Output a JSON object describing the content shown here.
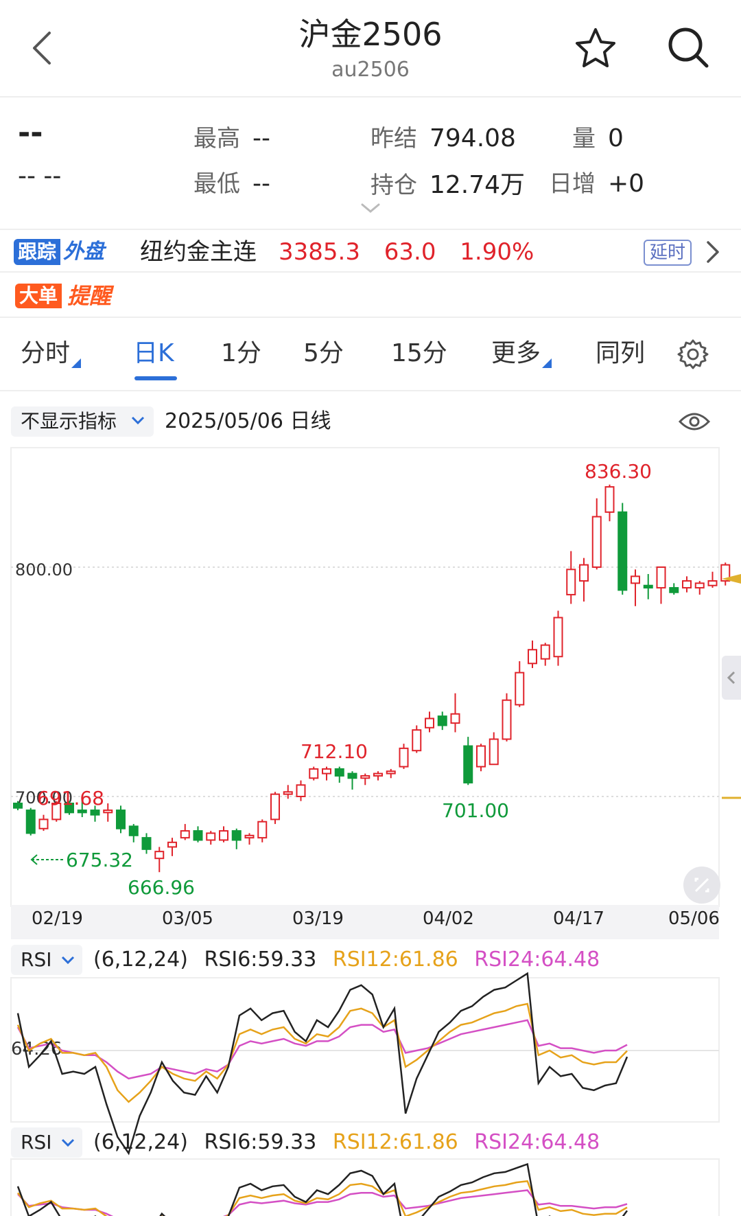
{
  "header": {
    "title": "沪金2506",
    "subtitle": "au2506",
    "icons": [
      "chevron-left-icon",
      "star-icon",
      "search-icon"
    ]
  },
  "quote": {
    "last_price": "--",
    "last_change": "-- --",
    "high_label": "最高",
    "high_value": "--",
    "low_label": "最低",
    "low_value": "--",
    "prev_settle_label": "昨结",
    "prev_settle_value": "794.08",
    "open_interest_label": "持仓",
    "open_interest_value": "12.74万",
    "volume_label": "量",
    "volume_value": "0",
    "daily_increase_label": "日增",
    "daily_increase_value": "+0"
  },
  "tracking": {
    "badge_a": "跟踪",
    "badge_b": "外盘",
    "name": "纽约金主连",
    "price": "3385.3",
    "change": "63.0",
    "change_pct": "1.90%",
    "delay_tag": "延时",
    "color": "#e0232b"
  },
  "big_order": {
    "badge_a": "大单",
    "badge_b": "提醒"
  },
  "tabs": [
    {
      "label": "分时",
      "has_menu": true
    },
    {
      "label": "日K",
      "active": true
    },
    {
      "label": "1分"
    },
    {
      "label": "5分"
    },
    {
      "label": "15分"
    },
    {
      "label": "更多",
      "has_menu": true
    },
    {
      "label": "同列"
    }
  ],
  "indicator_bar": {
    "select_label": "不显示指标",
    "date_label": "2025/05/06  日线"
  },
  "chart_data": {
    "type": "candlestick",
    "y_ticks": [
      "800.00",
      "700.00"
    ],
    "x_ticks": [
      "02/19",
      "03/05",
      "03/19",
      "04/02",
      "04/17",
      "05/06"
    ],
    "annotations": [
      {
        "text": "836.30",
        "kind": "high"
      },
      {
        "text": "712.10",
        "kind": "high"
      },
      {
        "text": "691.68",
        "kind": "high"
      },
      {
        "text": "701.00",
        "kind": "low"
      },
      {
        "text": "666.96",
        "kind": "low"
      },
      {
        "text": "675.32",
        "kind": "low",
        "arrow": true
      }
    ],
    "colors": {
      "up": "#e0232b",
      "down": "#0f9a3a",
      "rsi6": "#222222",
      "rsi12": "#e6a21a",
      "rsi24": "#d44fc4",
      "guide": "#e0b02e"
    },
    "candles": [
      [
        697,
        698,
        694,
        695
      ],
      [
        694,
        695,
        683,
        684
      ],
      [
        686,
        692,
        685,
        690
      ],
      [
        690,
        698,
        689,
        697
      ],
      [
        697,
        698,
        692,
        693
      ],
      [
        694,
        699,
        691,
        693
      ],
      [
        694,
        696,
        689,
        692
      ],
      [
        693,
        697,
        689,
        694
      ],
      [
        694,
        696,
        684,
        686
      ],
      [
        687,
        688,
        680,
        683
      ],
      [
        682,
        684,
        675,
        677
      ],
      [
        673,
        678,
        667,
        676
      ],
      [
        678,
        682,
        674,
        680
      ],
      [
        682,
        688,
        681,
        685
      ],
      [
        685,
        687,
        680,
        681
      ],
      [
        681,
        685,
        679,
        684
      ],
      [
        681,
        687,
        680,
        685
      ],
      [
        685,
        686,
        677,
        681
      ],
      [
        682,
        684,
        679,
        683
      ],
      [
        682,
        690,
        680,
        689
      ],
      [
        690,
        702,
        688,
        701
      ],
      [
        701,
        705,
        699,
        702
      ],
      [
        700,
        707,
        698,
        705
      ],
      [
        708,
        713,
        707,
        712
      ],
      [
        710,
        713,
        707,
        712
      ],
      [
        712,
        713,
        706,
        709
      ],
      [
        710,
        711,
        703,
        708
      ],
      [
        708,
        710,
        705,
        709
      ],
      [
        709,
        711,
        707,
        710
      ],
      [
        710,
        712,
        708,
        711
      ],
      [
        713,
        723,
        712,
        721
      ],
      [
        720,
        731,
        719,
        729
      ],
      [
        730,
        737,
        728,
        734
      ],
      [
        735,
        737,
        729,
        731
      ],
      [
        732,
        745,
        728,
        736
      ],
      [
        722,
        726,
        705,
        706
      ],
      [
        713,
        723,
        711,
        722
      ],
      [
        714,
        728,
        714,
        725
      ],
      [
        725,
        745,
        724,
        742
      ],
      [
        740,
        759,
        739,
        754
      ],
      [
        758,
        768,
        756,
        764
      ],
      [
        760,
        767,
        757,
        766
      ],
      [
        761,
        781,
        757,
        778
      ],
      [
        788,
        807,
        784,
        799
      ],
      [
        794,
        804,
        785,
        801
      ],
      [
        800,
        830,
        799,
        822
      ],
      [
        824,
        836,
        820,
        835
      ],
      [
        824,
        828,
        788,
        790
      ],
      [
        793,
        799,
        783,
        796
      ],
      [
        792,
        797,
        786,
        791
      ],
      [
        791,
        800,
        784,
        800
      ],
      [
        791,
        793,
        788,
        789
      ],
      [
        791,
        796,
        789,
        794
      ],
      [
        791,
        794,
        788,
        793
      ],
      [
        792,
        798,
        791,
        794
      ],
      [
        794,
        802,
        792,
        801
      ]
    ]
  },
  "rsi_panels": [
    {
      "select_label": "RSI",
      "params": "(6,12,24)",
      "rsi6": "RSI6:59.33",
      "rsi12": "RSI12:61.86",
      "rsi24": "RSI24:64.48",
      "axis_label": "64.26",
      "series": {
        "rsi6": [
          78,
          55,
          60,
          66,
          52,
          53,
          52,
          55,
          39,
          25,
          18,
          34,
          44,
          57,
          49,
          44,
          43,
          51,
          44,
          55,
          77,
          80,
          75,
          78,
          79,
          70,
          66,
          75,
          72,
          79,
          88,
          90,
          86,
          72,
          80,
          35,
          50,
          60,
          70,
          74,
          79,
          81,
          85,
          88,
          89,
          92,
          95,
          48,
          55,
          51,
          52,
          46,
          45,
          47,
          48,
          59.33
        ],
        "rsi12": [
          73,
          62,
          65,
          67,
          61,
          61,
          60,
          61,
          55,
          45,
          40,
          44,
          49,
          55,
          52,
          50,
          49,
          53,
          50,
          56,
          69,
          71,
          69,
          71,
          72,
          67,
          65,
          69,
          68,
          72,
          79,
          80,
          78,
          72,
          75,
          55,
          58,
          62,
          66,
          70,
          73,
          74,
          76,
          78,
          79,
          81,
          82,
          60,
          62,
          59,
          60,
          57,
          56,
          57,
          57,
          61.86
        ],
        "rsi24": [
          72,
          63,
          64,
          65,
          62,
          61,
          60,
          60,
          57,
          53,
          50,
          51,
          52,
          55,
          54,
          53,
          52,
          54,
          53,
          56,
          64,
          66,
          65,
          66,
          67,
          65,
          64,
          66,
          66,
          68,
          72,
          73,
          73,
          70,
          71,
          61,
          62,
          63,
          65,
          67,
          69,
          70,
          71,
          72,
          73,
          74,
          75,
          64,
          65,
          63,
          63,
          62,
          61,
          62,
          62,
          64.48
        ]
      }
    },
    {
      "select_label": "RSI",
      "params": "(6,12,24)",
      "rsi6": "RSI6:59.33",
      "rsi12": "RSI12:61.86",
      "rsi24": "RSI24:64.48"
    }
  ]
}
